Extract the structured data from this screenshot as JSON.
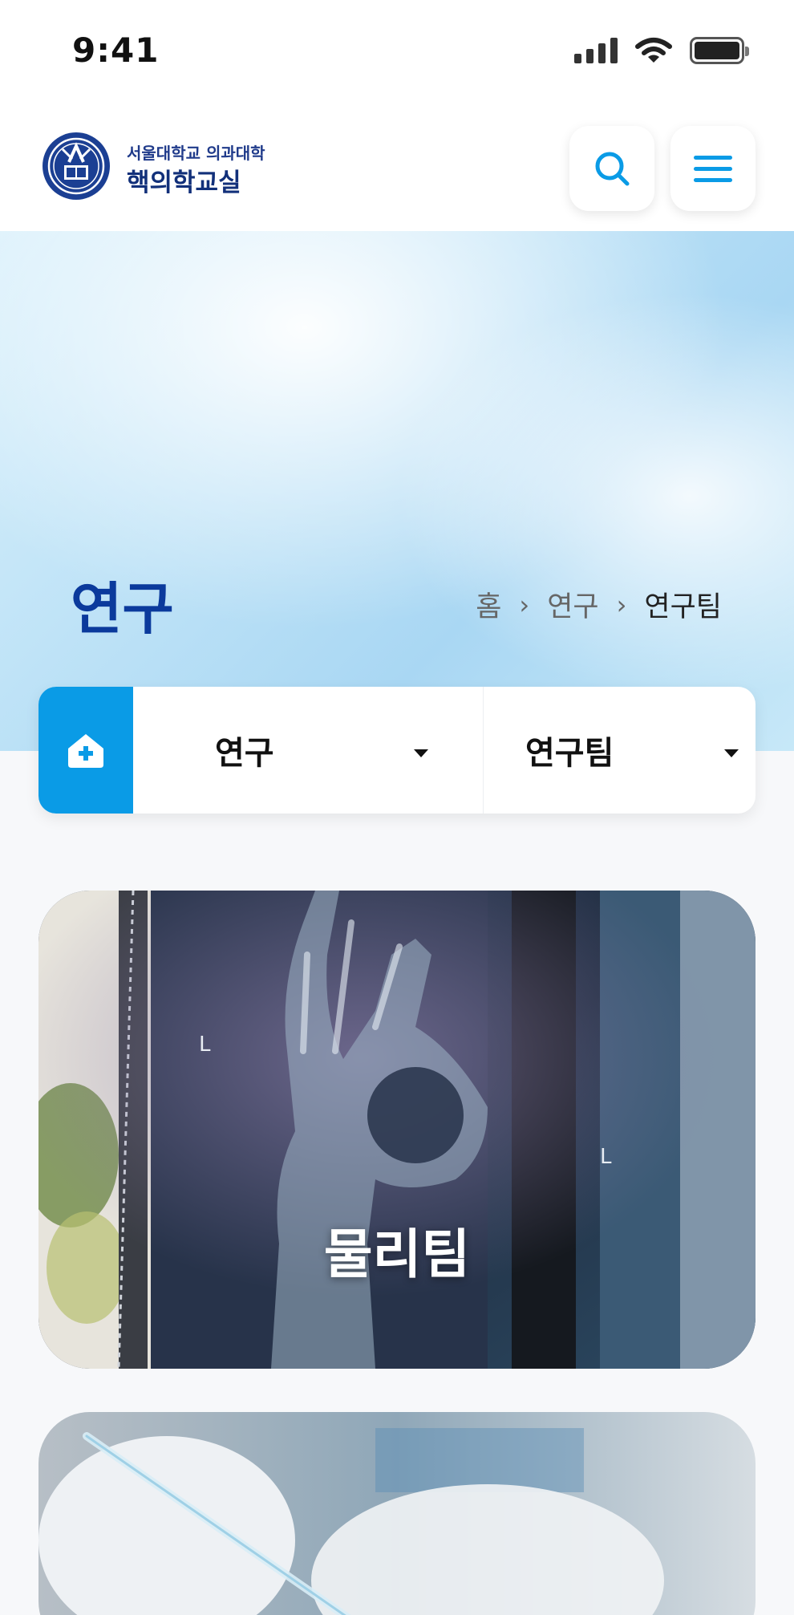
{
  "status_bar": {
    "time": "9:41"
  },
  "header": {
    "logo_subtitle": "서울대학교 의과대학",
    "logo_title": "핵의학교실"
  },
  "hero": {
    "title": "연구",
    "breadcrumb": [
      "홈",
      "연구",
      "연구팀"
    ]
  },
  "filter": {
    "category": "연구",
    "subcategory": "연구팀"
  },
  "cards": [
    {
      "title": "물리팀"
    },
    {
      "title": ""
    }
  ],
  "colors": {
    "accent": "#0a9be6",
    "title_blue": "#0b3a9c",
    "logo_navy": "#12307a"
  },
  "icons": [
    "signal-icon",
    "wifi-icon",
    "battery-icon",
    "search-icon",
    "menu-icon",
    "home-icon",
    "chevron-right-icon",
    "caret-down-icon"
  ]
}
